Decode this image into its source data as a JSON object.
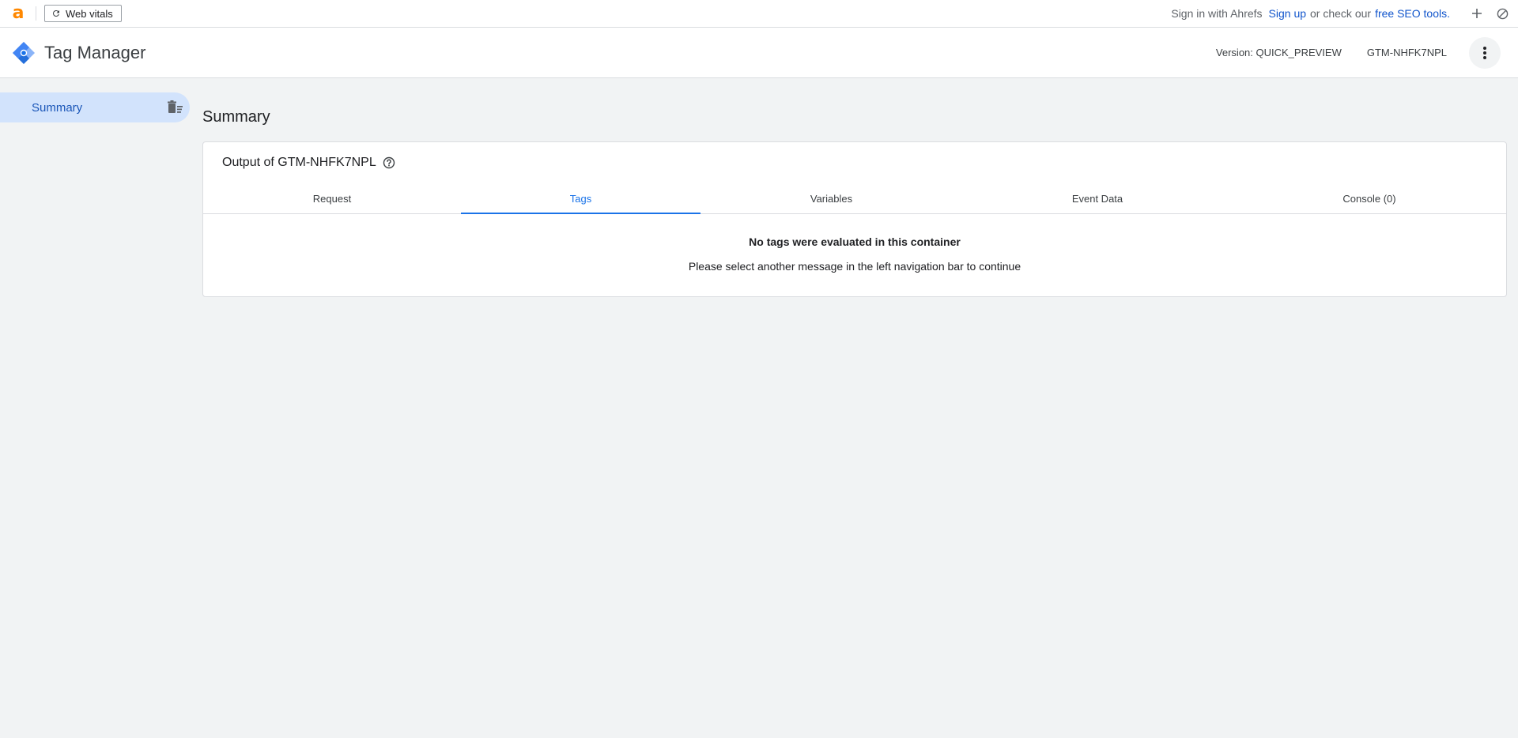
{
  "ext_bar": {
    "logo_letter": "a",
    "vitals_label": "Web vitals",
    "sign_in_text": "Sign in with Ahrefs",
    "sign_up_link": "Sign up",
    "or_text": "or check our",
    "seo_tools_link": "free SEO tools."
  },
  "header": {
    "title": "Tag Manager",
    "version": "Version: QUICK_PREVIEW",
    "container_id": "GTM-NHFK7NPL"
  },
  "sidebar": {
    "items": [
      {
        "label": "Summary"
      }
    ]
  },
  "main": {
    "page_title": "Summary",
    "card_title": "Output of GTM-NHFK7NPL",
    "tabs": [
      {
        "label": "Request"
      },
      {
        "label": "Tags"
      },
      {
        "label": "Variables"
      },
      {
        "label": "Event Data"
      },
      {
        "label": "Console (0)"
      }
    ],
    "active_tab": "Tags",
    "empty_headline": "No tags were evaluated in this container",
    "empty_sub": "Please select another message in the left navigation bar to continue"
  },
  "colors": {
    "accent": "#1a73e8",
    "sidebar_active_bg": "#d2e3fc",
    "ahrefs_orange": "#ff8800",
    "page_bg": "#f1f3f4"
  },
  "icons": {
    "ext_logo": "ahrefs-logo-icon",
    "vitals": "refresh-icon",
    "add": "plus-icon",
    "disable": "block-icon",
    "app_logo": "gtm-logo-icon",
    "more": "more-vert-icon",
    "clear": "clear-all-icon",
    "help": "help-icon"
  }
}
